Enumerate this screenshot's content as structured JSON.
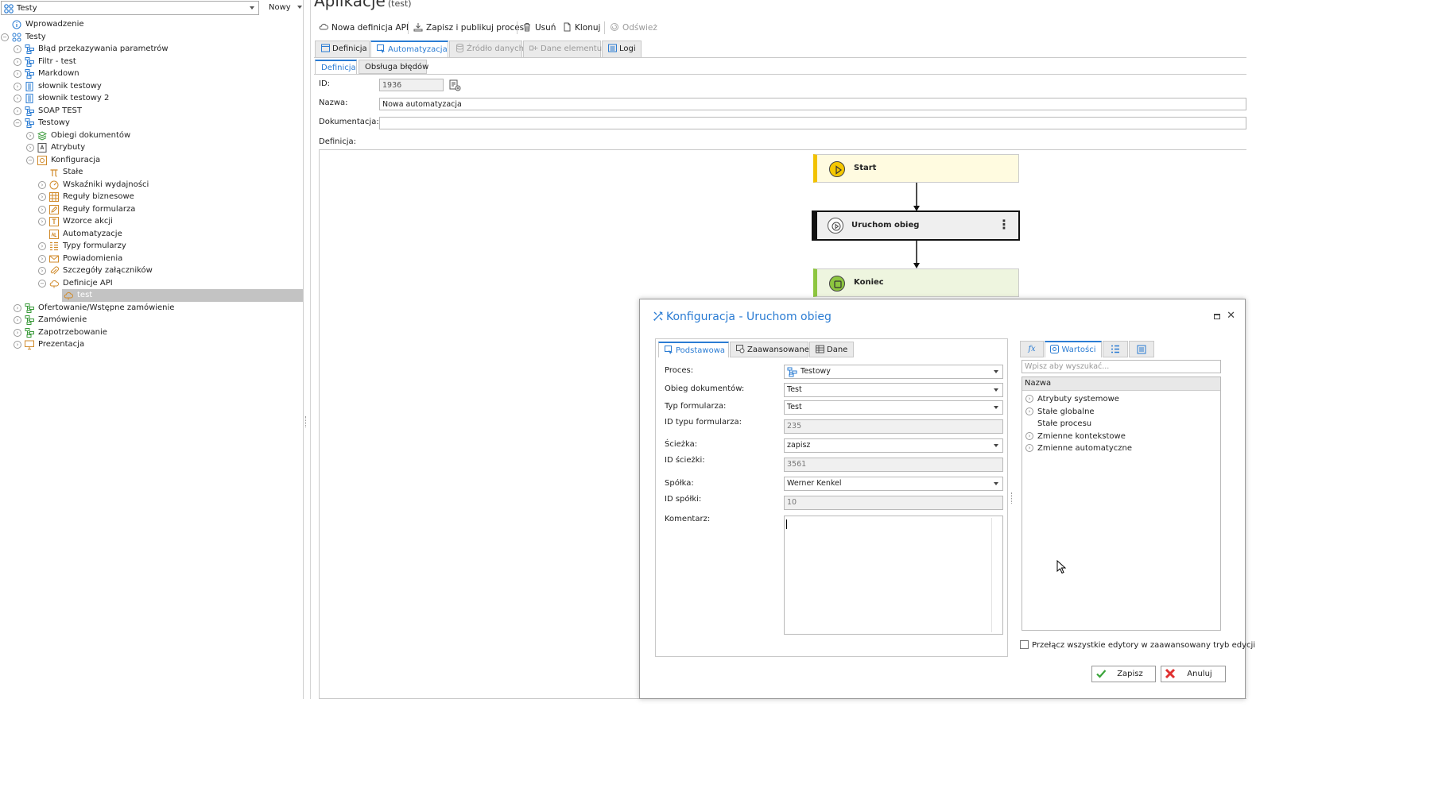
{
  "left_panel": {
    "selector_label": "Testy",
    "new_label": "Nowy",
    "tree": [
      {
        "label": "Wprowadzenie",
        "icon": "info-icon"
      },
      {
        "label": "Testy",
        "icon": "apps-icon"
      },
      {
        "label": "Błąd przekazywania parametrów",
        "icon": "process-icon"
      },
      {
        "label": "Filtr - test",
        "icon": "process-icon"
      },
      {
        "label": "Markdown",
        "icon": "process-icon"
      },
      {
        "label": "słownik testowy",
        "icon": "dictionary-icon"
      },
      {
        "label": "słownik testowy 2",
        "icon": "dictionary-icon"
      },
      {
        "label": "SOAP TEST",
        "icon": "process-icon"
      },
      {
        "label": "Testowy",
        "icon": "process-icon"
      },
      {
        "label": "Obiegi dokumentów",
        "icon": "workflow-layers-icon"
      },
      {
        "label": "Atrybuty",
        "icon": "attributes-icon"
      },
      {
        "label": "Konfiguracja",
        "icon": "config-gear-icon"
      },
      {
        "label": "Stałe",
        "icon": "pi-icon"
      },
      {
        "label": "Wskaźniki wydajności",
        "icon": "gauge-icon"
      },
      {
        "label": "Reguły biznesowe",
        "icon": "grid-icon"
      },
      {
        "label": "Reguły formularza",
        "icon": "pencil-icon"
      },
      {
        "label": "Wzorce akcji",
        "icon": "template-icon"
      },
      {
        "label": "Automatyzacje",
        "icon": "automation-icon"
      },
      {
        "label": "Typy formularzy",
        "icon": "form-types-icon"
      },
      {
        "label": "Powiadomienia",
        "icon": "envelope-icon"
      },
      {
        "label": "Szczegóły załączników",
        "icon": "paperclip-icon"
      },
      {
        "label": "Definicje API",
        "icon": "api-cloud-icon"
      },
      {
        "label": "test",
        "icon": "api-cloud-icon"
      },
      {
        "label": "Ofertowanie/Wstępne zamówienie",
        "icon": "process-green-icon"
      },
      {
        "label": "Zamówienie",
        "icon": "process-green-icon"
      },
      {
        "label": "Zapotrzebowanie",
        "icon": "process-green-icon"
      },
      {
        "label": "Prezentacja",
        "icon": "presentation-icon"
      }
    ]
  },
  "main": {
    "title": "Aplikacje",
    "title_suffix": "(test)",
    "toolbar": {
      "new_api": "Nowa definicja API",
      "save_publish": "Zapisz i publikuj proces",
      "delete": "Usuń",
      "clone": "Klonuj",
      "refresh": "Odśwież"
    },
    "tabs": {
      "definition": "Definicja",
      "automation": "Automatyzacja",
      "data_source": "Źródło danych",
      "element_data": "Dane elementu",
      "logs": "Logi"
    },
    "subtabs": {
      "definition": "Definicja",
      "error_handling": "Obsługa błędów"
    },
    "form": {
      "id_label": "ID:",
      "id_value": "1936",
      "name_label": "Nazwa:",
      "name_value": "Nowa automatyzacja",
      "doc_label": "Dokumentacja:",
      "doc_value": "",
      "definition_label": "Definicja:"
    },
    "flow": {
      "start": "Start",
      "action": "Uruchom obieg",
      "action_menu": "⋮",
      "end": "Koniec"
    }
  },
  "dialog": {
    "title": "Konfiguracja - Uruchom obieg",
    "tabs": {
      "basic": "Podstawowa",
      "advanced": "Zaawansowane",
      "data": "Dane"
    },
    "fields": {
      "process_label": "Proces:",
      "process_value": "Testowy",
      "workflow_label": "Obieg dokumentów:",
      "workflow_value": "Test",
      "formtype_label": "Typ formularza:",
      "formtype_value": "Test",
      "formtype_id_label": "ID typu formularza:",
      "formtype_id_value": "235",
      "path_label": "Ścieżka:",
      "path_value": "zapisz",
      "path_id_label": "ID ścieżki:",
      "path_id_value": "3561",
      "company_label": "Spółka:",
      "company_value": "Werner Kenkel",
      "company_id_label": "ID spółki:",
      "company_id_value": "10",
      "comment_label": "Komentarz:",
      "comment_value": ""
    },
    "right": {
      "fx_tab": "fx",
      "values_tab": "Wartości",
      "search_placeholder": "Wpisz aby wyszukać...",
      "column_header": "Nazwa",
      "items": [
        {
          "label": "Atrybuty systemowe",
          "expandable": true
        },
        {
          "label": "Stałe globalne",
          "expandable": true
        },
        {
          "label": "Stałe procesu",
          "expandable": false
        },
        {
          "label": "Zmienne kontekstowe",
          "expandable": true
        },
        {
          "label": "Zmienne automatyczne",
          "expandable": true
        }
      ]
    },
    "advanced_toggle_label": "Przełącz wszystkie edytory w zaawansowany tryb edycji",
    "save": "Zapisz",
    "cancel": "Anuluj"
  },
  "colors": {
    "accent": "#2b7cd3",
    "start": "#f2c200",
    "end": "#8dc63f",
    "tree_selected": "#c3c3c3",
    "save_green": "#3aa43a",
    "cancel_red": "#e03030"
  }
}
